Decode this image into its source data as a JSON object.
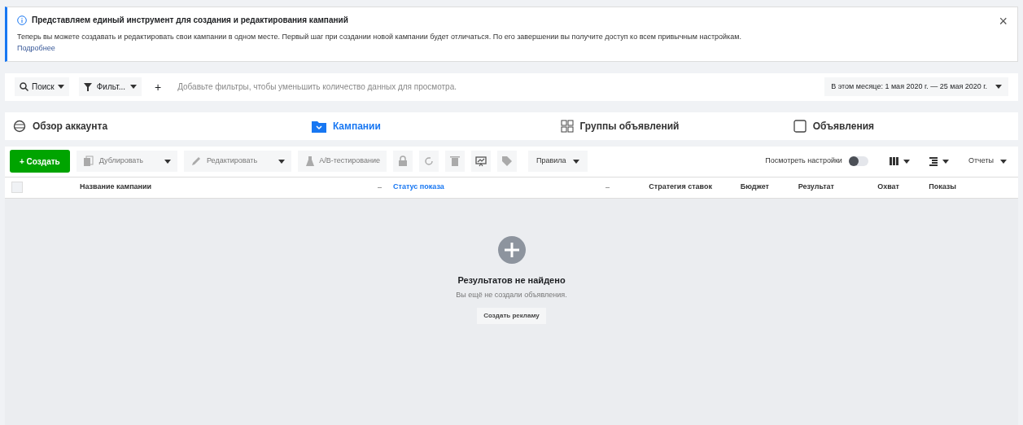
{
  "banner": {
    "title": "Представляем единый инструмент для создания и редактирования кампаний",
    "text": "Теперь вы можете создавать и редактировать свои кампании в одном месте. Первый шаг при создании новой кампании будет отличаться. По его завершении вы получите доступ ко всем привычным настройкам.",
    "link": "Подробнее",
    "close": "×"
  },
  "filter_bar": {
    "search": "Поиск",
    "filter": "Фильт...",
    "add": "+",
    "placeholder": "Добавьте фильтры, чтобы уменьшить количество данных для просмотра.",
    "date_range": "В этом месяце: 1 мая 2020 г. — 25 мая 2020 г."
  },
  "tabs": [
    {
      "label": "Обзор аккаунта",
      "kind": "overview",
      "selected": false
    },
    {
      "label": "Кампании",
      "kind": "campaigns",
      "selected": true
    },
    {
      "label": "Группы объявлений",
      "kind": "ad_sets",
      "selected": false
    },
    {
      "label": "Объявления",
      "kind": "ads",
      "selected": false
    }
  ],
  "toolbar": {
    "buttons": [
      {
        "kind": "create",
        "label": "+ Создать",
        "disabled": false
      },
      {
        "kind": "duplicate",
        "label": "Дублировать",
        "disabled": true
      },
      {
        "kind": "edit",
        "label": "Редактировать",
        "disabled": true
      },
      {
        "kind": "ab_test",
        "label": "A/B-тестирование",
        "disabled": true
      },
      {
        "kind": "lock",
        "disabled": true
      },
      {
        "kind": "undo",
        "disabled": true
      },
      {
        "kind": "trash",
        "disabled": true
      },
      {
        "kind": "chart",
        "disabled": false
      },
      {
        "kind": "tag",
        "disabled": true
      },
      {
        "kind": "rules",
        "label": "Правила",
        "disabled": false
      }
    ],
    "toggle": {
      "label": "Посмотреть настройки",
      "on": false
    },
    "right_buttons": [
      {
        "kind": "columns"
      },
      {
        "kind": "breakdown"
      },
      {
        "kind": "reports",
        "label": "Отчеты"
      }
    ]
  },
  "table": {
    "select_all": {
      "checked": false
    },
    "columns": [
      {
        "label": "Название кампании",
        "selected": false,
        "sort_marker": true
      },
      {
        "label": "Статус показа",
        "selected": true,
        "sort_marker": true
      },
      {
        "label": "Стратегия ставок",
        "selected": false,
        "sort_marker": false
      },
      {
        "label": "Бюджет",
        "selected": false,
        "sort_marker": false
      },
      {
        "label": "Результат",
        "selected": false,
        "sort_marker": false
      },
      {
        "label": "Охват",
        "selected": false,
        "sort_marker": false
      },
      {
        "label": "Показы",
        "selected": false,
        "sort_marker": false
      }
    ]
  },
  "empty_state": {
    "title": "Результатов не найдено",
    "text": "Вы ещё не создали объявления.",
    "button": "Создать рекламу"
  }
}
